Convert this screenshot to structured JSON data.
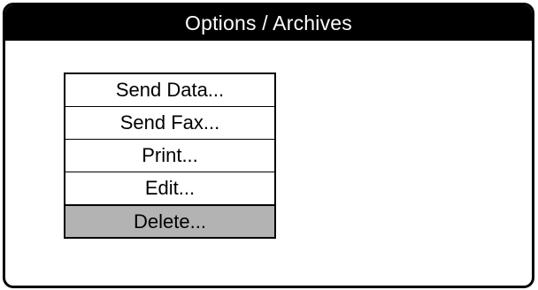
{
  "window": {
    "title": "Options / Archives"
  },
  "menu": {
    "items": [
      {
        "label": "Send Data..."
      },
      {
        "label": "Send Fax..."
      },
      {
        "label": "Print..."
      },
      {
        "label": "Edit..."
      },
      {
        "label": "Delete..."
      }
    ],
    "selected_index": 4
  },
  "colors": {
    "title_bar_bg": "#000000",
    "title_bar_text": "#ffffff",
    "selected_item_bg": "#b3b3b3"
  }
}
